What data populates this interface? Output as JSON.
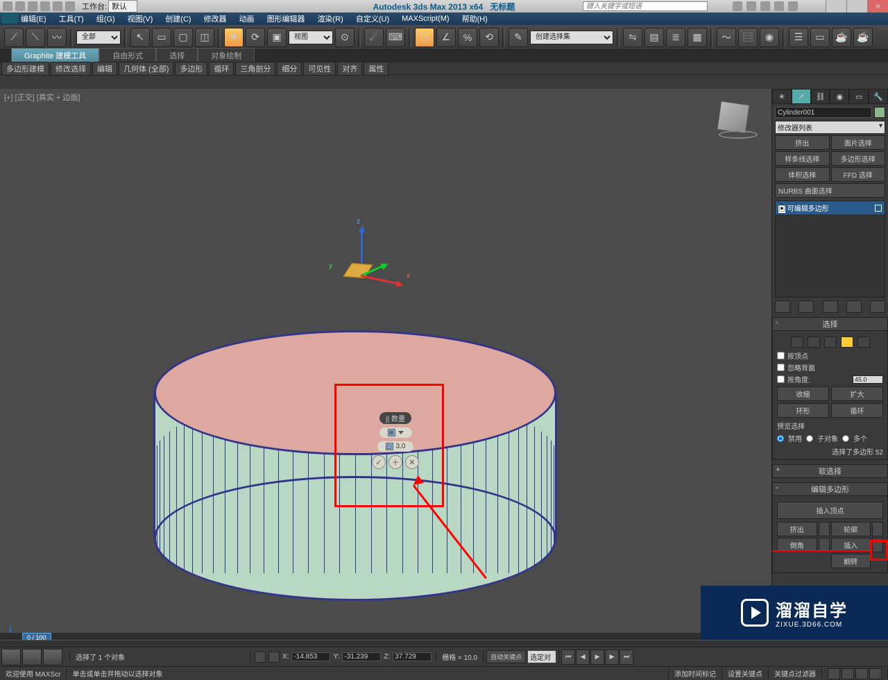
{
  "title": {
    "workspace_label": "工作台:",
    "workspace_value": "默认",
    "app": "Autodesk 3ds Max  2013 x64",
    "doc": "无标题",
    "search_placeholder": "键入关键字或短语"
  },
  "menu": [
    "编辑(E)",
    "工具(T)",
    "组(G)",
    "视图(V)",
    "创建(C)",
    "修改器",
    "动画",
    "图形编辑器",
    "渲染(R)",
    "自定义(U)",
    "MAXScript(M)",
    "帮助(H)"
  ],
  "toolbar": {
    "sel_filter": "全部",
    "ref_sys": "视图",
    "named_sel": "创建选择集"
  },
  "ribbon": {
    "tabs": [
      "Graphite 建模工具",
      "自由形式",
      "选择",
      "对象绘制"
    ],
    "sub": [
      "多边形建模",
      "修改选择",
      "编辑",
      "几何体 (全部)",
      "多边形",
      "循环",
      "三角剖分",
      "细分",
      "可见性",
      "对齐",
      "属性"
    ]
  },
  "viewport": {
    "label": "[+] [正交] [真实 + 边面]"
  },
  "caddy": {
    "label": "|| 数量",
    "value": "3.0"
  },
  "panel": {
    "object": "Cylinder001",
    "modifier_dropdown": "修改器列表",
    "mod_buttons": [
      "挤出",
      "面片选择",
      "样条线选择",
      "多边形选择",
      "体积选择",
      "FFD 选择"
    ],
    "mod_full": "NURBS 曲面选择",
    "stack_entry": "可编辑多边形",
    "rollouts": {
      "select": {
        "title": "选择",
        "by_vertex": "按顶点",
        "ignore_backface": "忽略背面",
        "by_angle": "按角度:",
        "angle_value": "45.0",
        "shrink": "收缩",
        "grow": "扩大",
        "ring": "环形",
        "loop": "循环",
        "preview_label": "预览选择",
        "opts": [
          "禁用",
          "子对象",
          "多个"
        ],
        "count": "选择了多边形 52"
      },
      "soft": {
        "title": "软选择"
      },
      "editpoly": {
        "title": "编辑多边形",
        "ins_vtx": "插入顶点",
        "extrude": "挤出",
        "outline": "轮廓",
        "bevel": "倒角",
        "inset": "插入",
        "flip": "翻转"
      }
    }
  },
  "timeline": {
    "cursor": "0 / 100"
  },
  "trackbar": {
    "status": "选择了 1 个对象",
    "x": "-14.853",
    "y": "-31.239",
    "z": "37.729",
    "grid": "栅格 = 10.0",
    "auto_key": "自动关键点",
    "set_key": "设置关键点",
    "sel_set": "选定对",
    "key_filters": "关键点过滤器"
  },
  "statusbar": {
    "welcome": "欢迎使用  MAXScr",
    "prompt": "单击或单击并拖动以选择对象",
    "addtime": "添加时间标记"
  },
  "watermark": {
    "big": "溜溜自学",
    "small": "ZIXUE.3D66.COM"
  }
}
